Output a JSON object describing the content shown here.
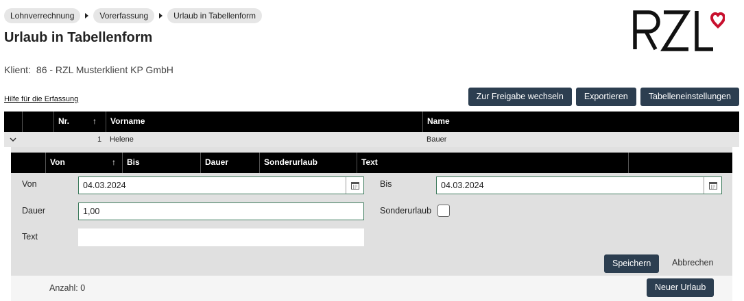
{
  "breadcrumb": [
    "Lohnverrechnung",
    "Vorerfassung",
    "Urlaub in Tabellenform"
  ],
  "page_title": "Urlaub in Tabellenform",
  "logo_text": "RZL",
  "client": {
    "label": "Klient:",
    "value": "86 - RZL Musterklient KP GmbH"
  },
  "help_link": "Hilfe für die Erfassung",
  "toolbar": {
    "release": "Zur Freigabe wechseln",
    "export": "Exportieren",
    "settings": "Tabelleneinstellungen"
  },
  "grid": {
    "columns": {
      "nr": "Nr.",
      "vorname": "Vorname",
      "name": "Name"
    },
    "row": {
      "nr": "1",
      "vorname": "Helene",
      "name": "Bauer"
    }
  },
  "detail": {
    "columns": {
      "von": "Von",
      "bis": "Bis",
      "dauer": "Dauer",
      "sonderurlaub": "Sonderurlaub",
      "text": "Text"
    },
    "form": {
      "von_label": "Von",
      "von_value": "04.03.2024",
      "bis_label": "Bis",
      "bis_value": "04.03.2024",
      "dauer_label": "Dauer",
      "dauer_value": "1,00",
      "sonderurlaub_label": "Sonderurlaub",
      "sonderurlaub_checked": false,
      "text_label": "Text",
      "text_value": ""
    },
    "save": "Speichern",
    "cancel": "Abbrechen",
    "count_label": "Anzahl:",
    "count_value": "0",
    "new_button": "Neuer Urlaub"
  },
  "colors": {
    "dark_button": "#2c3e50",
    "header": "#000000",
    "field_border": "#3d7a5c",
    "logo_heart": "#c8102e"
  }
}
